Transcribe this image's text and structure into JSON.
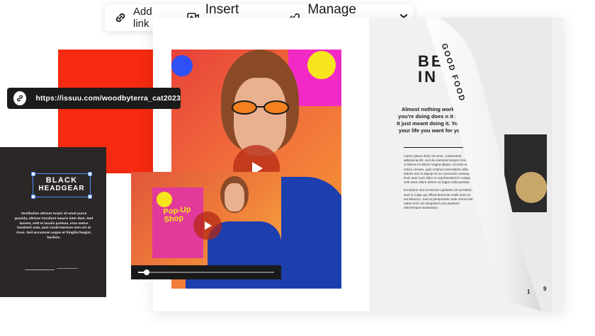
{
  "toolbar": {
    "add_link_label": "Add link",
    "insert_video_label": "Insert video",
    "manage_links_label": "Manage links"
  },
  "link": {
    "url": "https://issuu.com/woodbyterra_cat2023"
  },
  "black_doc": {
    "title_line1": "BLACK",
    "title_line2": "HEADGEAR",
    "body": "Vestibulum ultrices turpis sit amet purus gravida, ultrices tincidunt mauris inter-dum. Sed laoreet, velit et iaculis pretium, eros metus hendrerit ante, quis condi-mentum sem est at risus. Sed accumsan augue at fringilla feugiat, facilisis."
  },
  "magazine": {
    "right_title": "BE\nIN",
    "curl_text": "GOOD FOOD",
    "quote": "Almost nothing works the what you're doing does n it won't work. It just meant doing it. You can't live your life you want for you, even if",
    "body_1": "Lorem ipsum dolor sit amet, consectetur adipiscing elit, sed do eiusmod tempor incididunt ut labore et dolore magna aliqua. Ut enim ad minim veniam, quis nostrud exercitation ullamco laboris nisi ut aliquip ex ea commodo consequat. Duis aute irure dolor in reprehenderit in voluptate velit esse cillum dolore eu fugiat nulla pariatur.",
    "body_2": "Excepteur sint occaecat cupidatat non proident, sunt in culpa qui officia deserunt mollit anim id est laborum. Sed ut perspiciatis unde omnis iste natus error sit voluptatem accusantium doloremque laudantium.",
    "page_left": "1",
    "page_right": "9"
  },
  "video": {
    "poster_text": "Pop-Up\nShop",
    "progress": 0.06
  },
  "colors": {
    "accent_red": "#f52a10",
    "selection_blue": "#4d8bff",
    "dark": "#1b1b1b"
  },
  "icons": {
    "add_link": "link-icon",
    "insert_video": "video-plus-icon",
    "manage_links": "link-gear-icon",
    "dropdown": "chevron-down-icon",
    "url": "link-icon",
    "play": "play-icon"
  }
}
